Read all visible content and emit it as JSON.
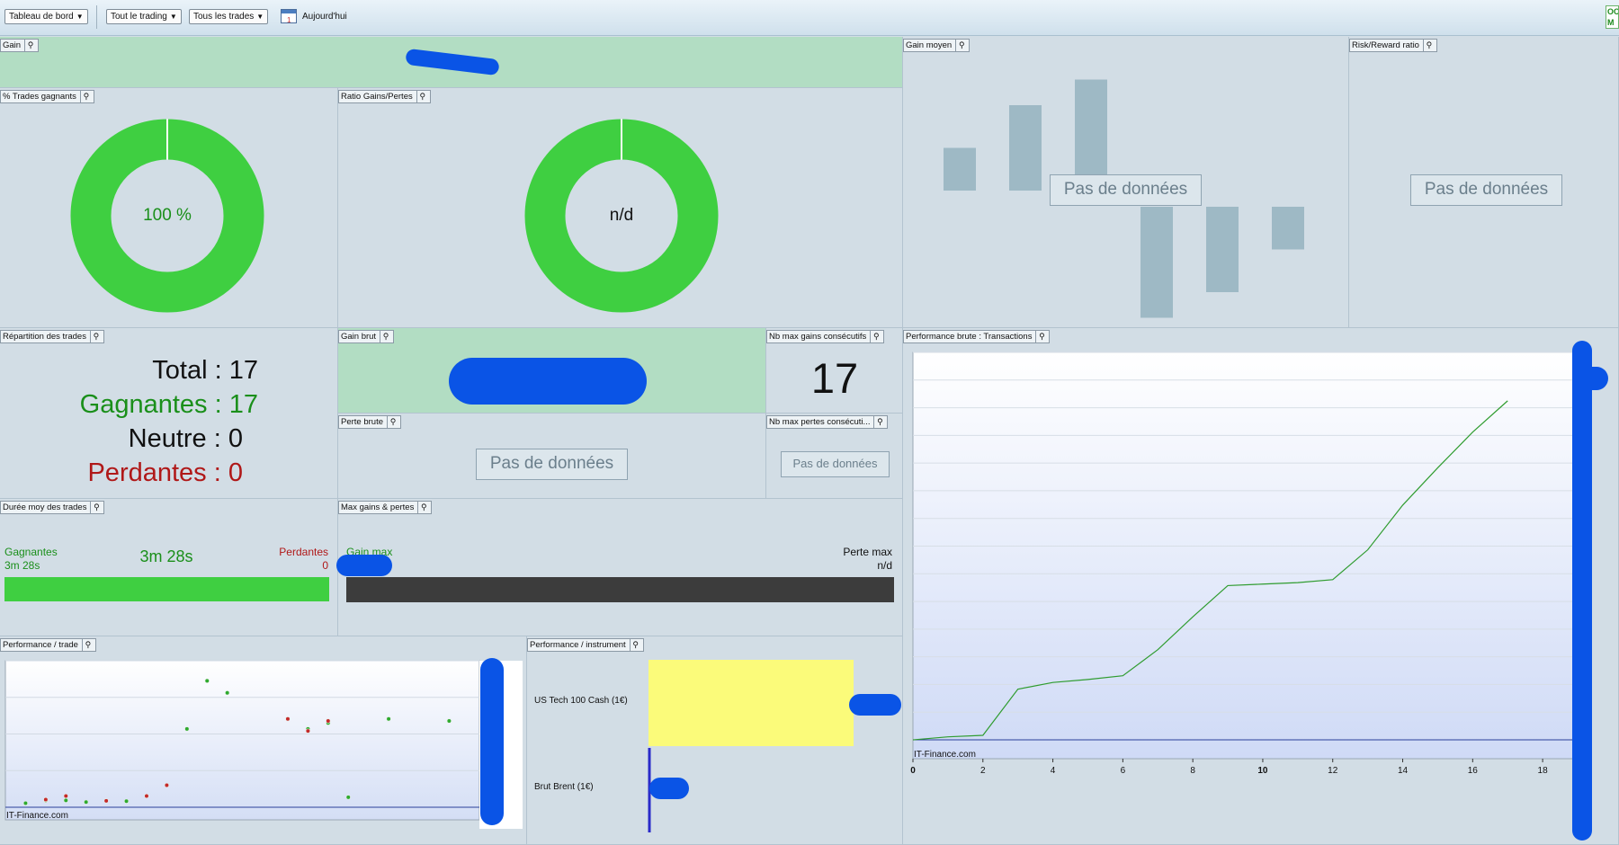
{
  "toolbar": {
    "dashboard_label": "Tableau de bord",
    "trading_label": "Tout le trading",
    "trades_label": "Tous les trades",
    "today_label": "Aujourd'hui"
  },
  "panels": {
    "gain": "Gain",
    "gain_moyen": "Gain moyen",
    "risk_reward": "Risk/Reward ratio",
    "pct_trades": "% Trades gagnants",
    "ratio_gains": "Ratio Gains/Pertes",
    "repartition": "Répartition des trades",
    "gain_brut": "Gain brut",
    "nb_max_gains": "Nb max gains consécutifs",
    "perte_brute": "Perte brute",
    "nb_max_pertes": "Nb max pertes consécuti...",
    "perf_brute": "Performance brute : Transactions",
    "duree_moy": "Durée moy des trades",
    "max_gains_pertes": "Max gains & pertes",
    "perf_trade": "Performance / trade",
    "perf_instrument": "Performance / instrument"
  },
  "nodata": "Pas de données",
  "pct_trades_value": "100 %",
  "pct_trades_fraction": 1.0,
  "ratio_value": "n/d",
  "ratio_fraction": 1.0,
  "repartition": {
    "total_label": "Total :",
    "total": "17",
    "win_label": "Gagnantes :",
    "win": "17",
    "neutral_label": "Neutre :",
    "neutral": "0",
    "loss_label": "Perdantes :",
    "loss": "0"
  },
  "nb_max_gains_value": "17",
  "duree": {
    "win_label": "Gagnantes",
    "win_value": "3m 28s",
    "center_value": "3m 28s",
    "loss_label": "Perdantes",
    "loss_value": "0"
  },
  "max_gp": {
    "gain_label": "Gain max",
    "loss_label": "Perte max",
    "loss_value": "n/d"
  },
  "instruments": [
    "US Tech 100 Cash (1€)",
    "Brut Brent (1€)"
  ],
  "watermark": "IT-Finance.com",
  "colors": {
    "green": "#3fcf41",
    "dark_green": "#1a8f1a",
    "red": "#c01515",
    "yellow": "#fbfb7a",
    "redact_blue": "#0a54e6"
  },
  "chart_data": [
    {
      "type": "line",
      "title": "Performance brute : Transactions",
      "x_ticks": [
        "0",
        "2",
        "4",
        "6",
        "8",
        "10",
        "12",
        "14",
        "16",
        "18"
      ],
      "xlim": [
        0,
        19
      ],
      "x": [
        0,
        1,
        2,
        3,
        4,
        5,
        6,
        7,
        8,
        9,
        10,
        11,
        12,
        13,
        14,
        15,
        16,
        17
      ],
      "values": [
        0,
        0.4,
        0.6,
        6.8,
        7.7,
        8.1,
        8.6,
        12.1,
        16.5,
        20.7,
        20.9,
        21.1,
        21.5,
        25.5,
        31.5,
        36.5,
        41.3,
        45.5
      ],
      "ylim": [
        0,
        52
      ],
      "y_gridlines": 14
    },
    {
      "type": "scatter",
      "title": "Performance / trade",
      "series": [
        {
          "color": "green",
          "points": [
            [
              1,
              0.5
            ],
            [
              2,
              1.2
            ],
            [
              3,
              1.2
            ],
            [
              4,
              0.8
            ],
            [
              6,
              1.0
            ],
            [
              9,
              19.0
            ],
            [
              10,
              31.0
            ],
            [
              11,
              28.0
            ],
            [
              15,
              19.0
            ],
            [
              16,
              20.5
            ],
            [
              17,
              2.0
            ],
            [
              19,
              21.5
            ],
            [
              22,
              21.0
            ]
          ]
        },
        {
          "color": "red",
          "points": [
            [
              2,
              1.4
            ],
            [
              3,
              2.3
            ],
            [
              5,
              1.1
            ],
            [
              7,
              2.3
            ],
            [
              8,
              5.0
            ],
            [
              14,
              21.5
            ],
            [
              15,
              18.5
            ],
            [
              16,
              21.0
            ]
          ]
        }
      ],
      "xlim": [
        0,
        23.5
      ],
      "ylim": [
        -0.5,
        36
      ]
    },
    {
      "type": "bar",
      "title": "Performance / instrument",
      "categories": [
        "US Tech 100 Cash (1€)",
        "Brut Brent (1€)"
      ],
      "values": [
        1.0,
        0.0
      ],
      "xlim": [
        0,
        1.0
      ]
    },
    {
      "type": "bar",
      "title": "Gain moyen",
      "values": [
        1.0,
        2.0,
        2.6,
        -2.6,
        -2.0,
        -1.0
      ],
      "ylim": [
        -3,
        3
      ]
    }
  ]
}
